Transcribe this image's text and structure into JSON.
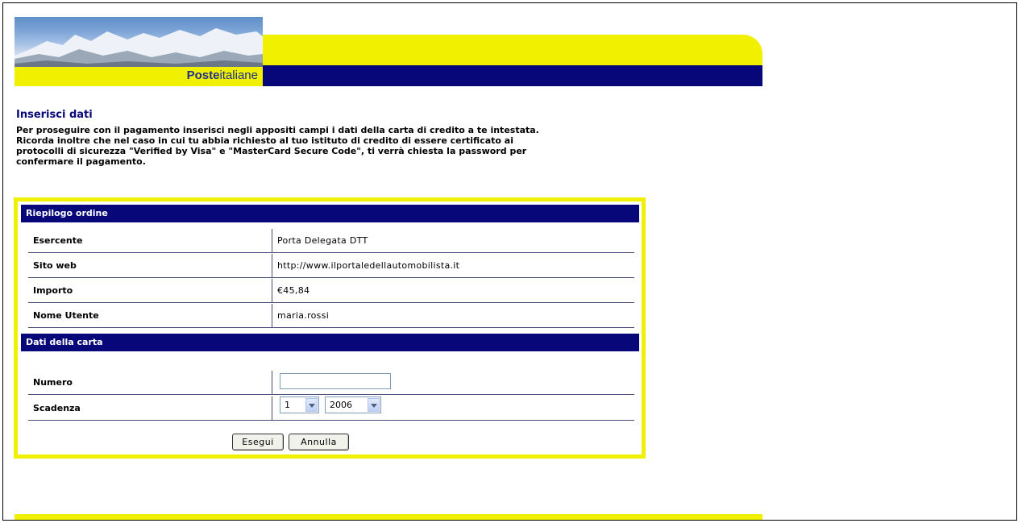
{
  "header": {
    "logo_bold": "Poste",
    "logo_rest": "italiane"
  },
  "intro": {
    "title": "Inserisci dati",
    "text": "Per proseguire con il pagamento inserisci negli appositi campi i dati della carta di credito a te intestata. Ricorda inoltre che nel caso in cui tu abbia richiesto al tuo istituto di credito di essere certificato ai protocolli di sicurezza \"Verified by Visa\" e \"MasterCard Secure Code\", ti verrà chiesta la password per confermare il pagamento."
  },
  "order": {
    "heading": "Riepilogo ordine",
    "rows": [
      {
        "label": "Esercente",
        "value": "Porta Delegata DTT"
      },
      {
        "label": "Sito web",
        "value": "http://www.ilportaledellautomobilista.it"
      },
      {
        "label": "Importo",
        "value": "€45,84"
      },
      {
        "label": "Nome Utente",
        "value": "maria.rossi"
      }
    ]
  },
  "card": {
    "heading": "Dati della carta",
    "number_label": "Numero",
    "number_value": "",
    "expiry_label": "Scadenza",
    "month_value": "1",
    "year_value": "2006"
  },
  "buttons": {
    "submit": "Esegui",
    "cancel": "Annulla"
  },
  "colors": {
    "yellow": "#f0f000",
    "navy": "#07077a"
  }
}
